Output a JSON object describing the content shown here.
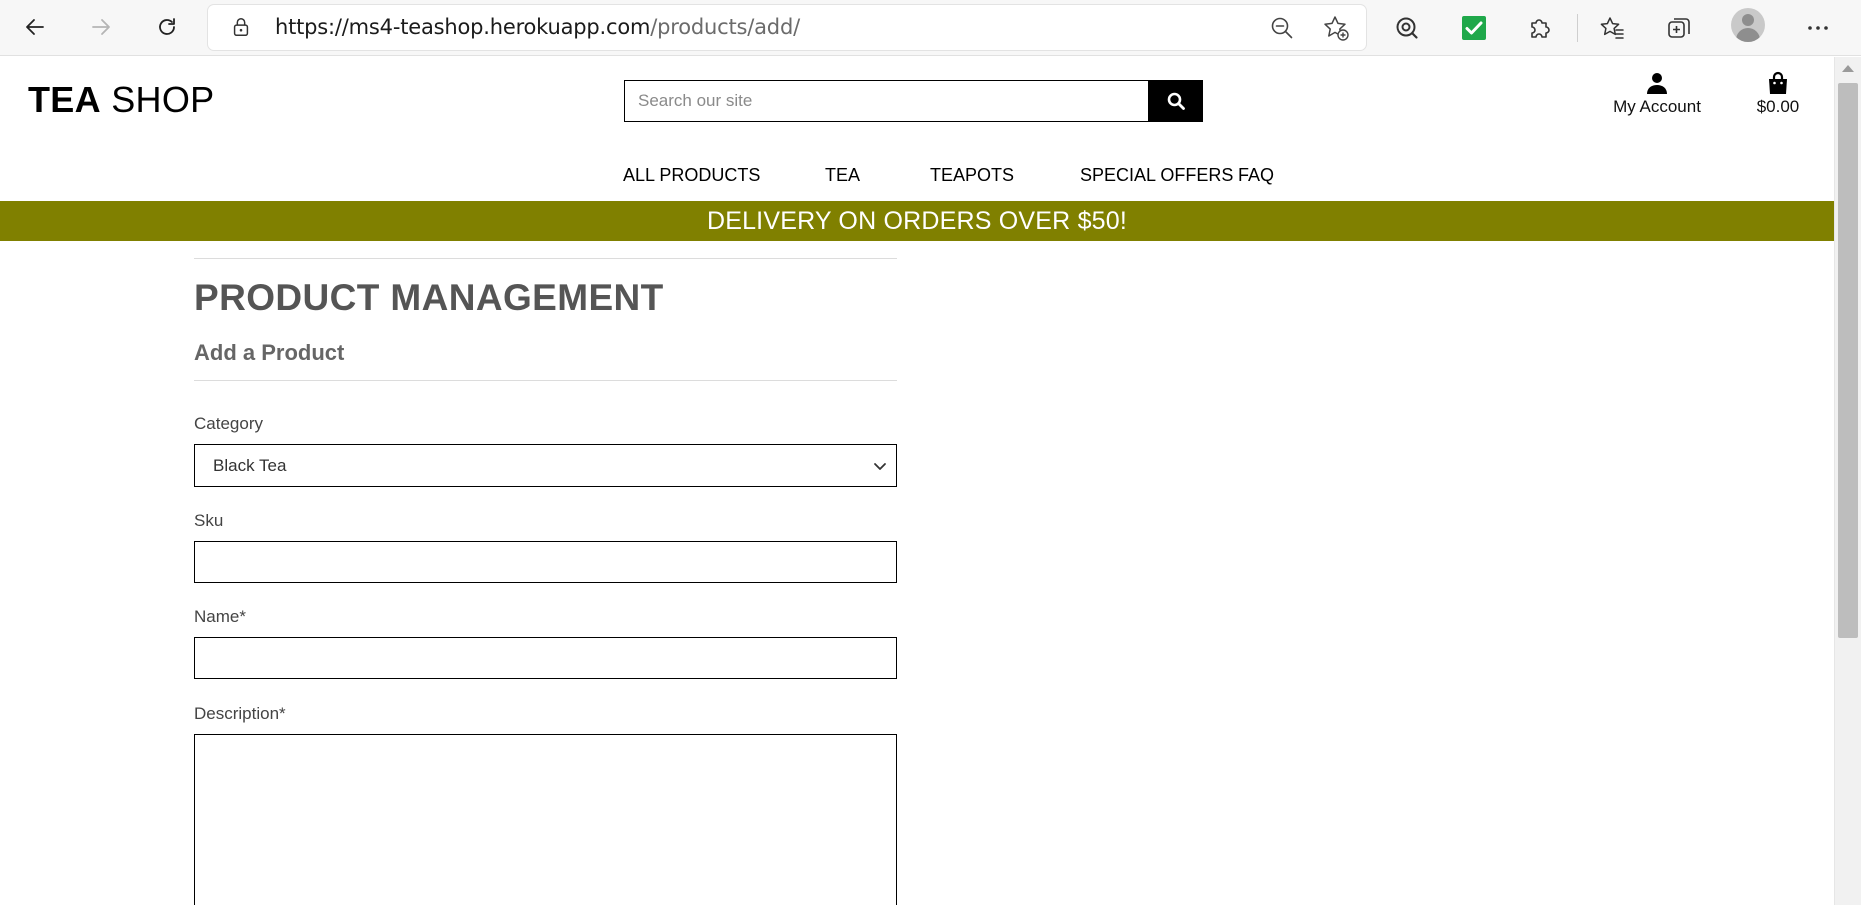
{
  "browser": {
    "url_host": "https://ms4-teashop.herokuapp.com",
    "url_path": "/products/add/"
  },
  "site": {
    "logo_bold": "TEA",
    "logo_light": "SHOP",
    "search_placeholder": "Search our site",
    "account_label": "My Account",
    "bag_total": "$0.00"
  },
  "nav": {
    "items": [
      "ALL PRODUCTS",
      "TEA",
      "TEAPOTS",
      "SPECIAL OFFERS",
      "FAQ"
    ]
  },
  "banner": {
    "text": "DELIVERY ON ORDERS OVER $50!"
  },
  "page": {
    "title": "PRODUCT MANAGEMENT",
    "subtitle": "Add a Product"
  },
  "form": {
    "category_label": "Category",
    "category_value": "Black Tea",
    "sku_label": "Sku",
    "sku_value": "",
    "name_label": "Name*",
    "name_value": "",
    "description_label": "Description*",
    "description_value": ""
  },
  "colors": {
    "banner_bg": "#808000",
    "banner_text": "#ffffff",
    "search_button": "#000000",
    "checkmark_extension": "#1fa84a"
  },
  "icons": {
    "back": "arrow-left-icon",
    "forward": "arrow-right-icon",
    "refresh": "refresh-icon",
    "lock": "lock-icon",
    "zoom_out": "zoom-out-icon",
    "favorite_add": "star-plus-icon",
    "tracker": "shield-search-icon",
    "check": "check-icon",
    "extensions": "puzzle-icon",
    "favorites": "favorites-icon",
    "collections": "collections-icon",
    "profile": "avatar-icon",
    "more": "more-icon",
    "search": "search-icon",
    "user": "user-icon",
    "bag": "shopping-bag-icon",
    "chevron": "chevron-down-icon"
  }
}
